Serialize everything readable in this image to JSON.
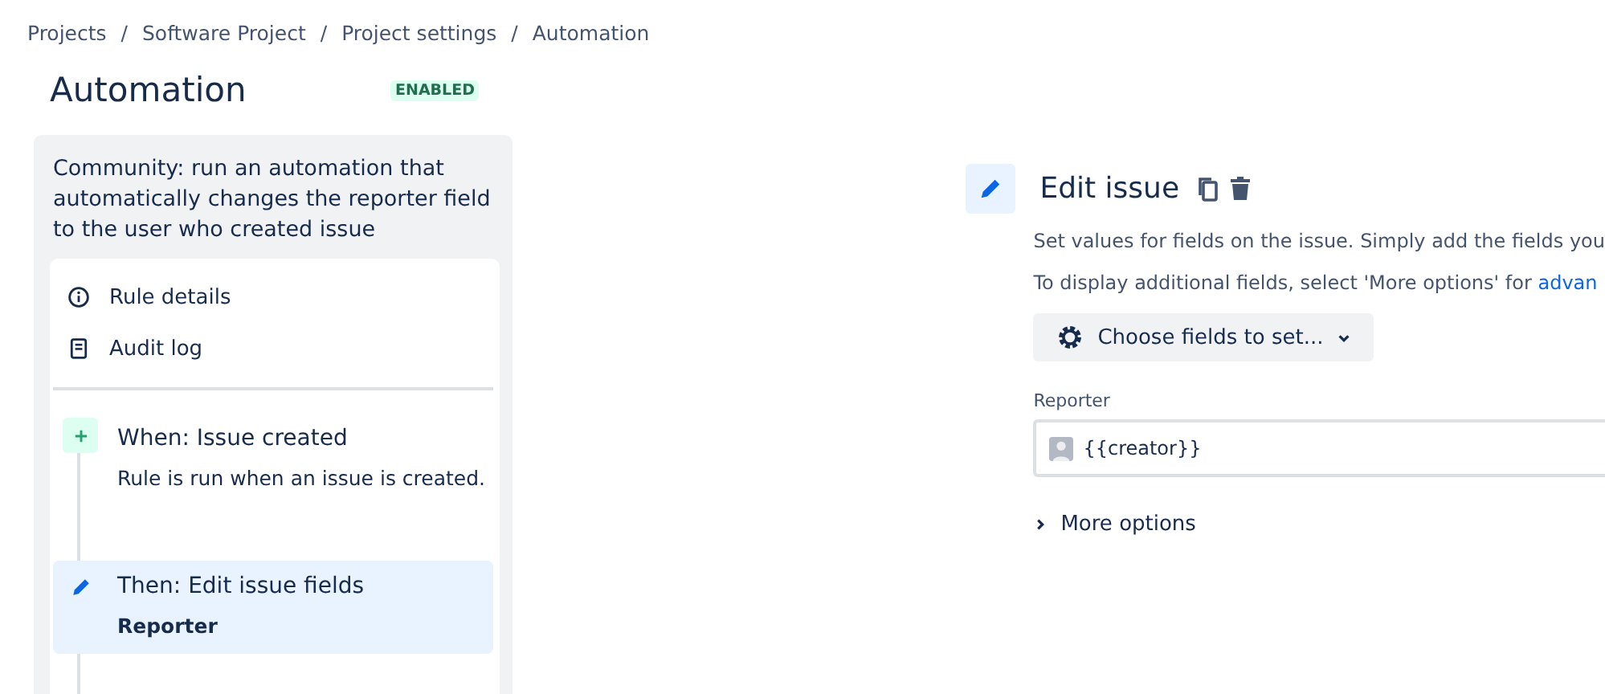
{
  "breadcrumbs": [
    "Projects",
    "Software Project",
    "Project settings",
    "Automation"
  ],
  "breadcrumb_separator": "/",
  "page": {
    "title": "Automation",
    "status": "ENABLED"
  },
  "rule": {
    "title": "Community: run an automation that automatically changes the reporter field to the user who created issue",
    "menu": [
      {
        "kind": "info",
        "label": "Rule details"
      },
      {
        "kind": "log",
        "label": "Audit log"
      }
    ],
    "steps": [
      {
        "kind": "trigger",
        "title": "When: Issue created",
        "detail": "Rule is run when an issue is created.",
        "selected": false
      },
      {
        "kind": "action",
        "title": "Then: Edit issue fields",
        "detail": "Reporter",
        "selected": true
      }
    ]
  },
  "editor": {
    "title": "Edit issue",
    "description": "Set values for fields on the issue. Simply add the fields you",
    "hint": "To display additional fields, select 'More options' for",
    "hint_link": "advan",
    "choose_button": "Choose fields to set...",
    "fields": [
      {
        "label": "Reporter",
        "value": "{{creator}}"
      }
    ],
    "more_options": "More options"
  }
}
